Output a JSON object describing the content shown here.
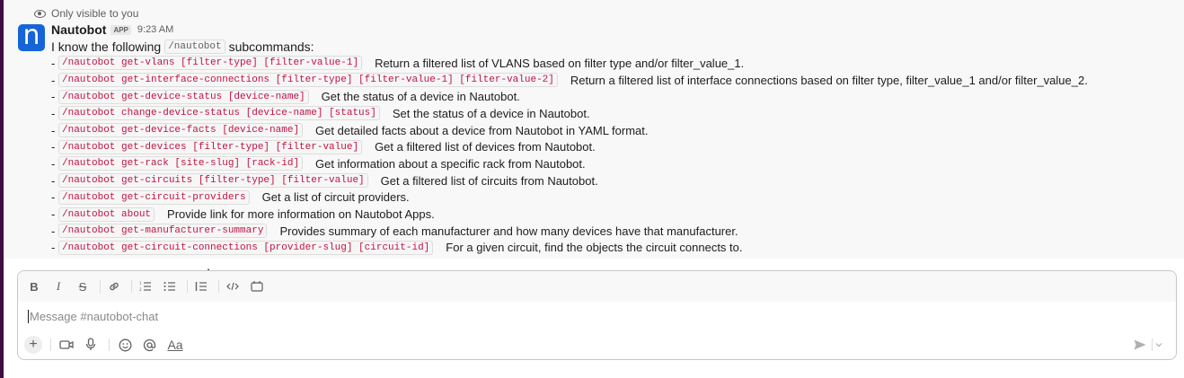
{
  "visibility_note": "Only visible to you",
  "message": {
    "avatar_letter": "n",
    "bot_name": "Nautobot",
    "app_badge": "APP",
    "timestamp": "9:23 AM",
    "intro_before": "I know the following",
    "intro_code": "/nautobot",
    "intro_after": "subcommands:",
    "bullet": "-",
    "commands": [
      {
        "cmd": "/nautobot get-vlans [filter-type] [filter-value-1]",
        "desc": "Return a filtered list of VLANS based on filter type and/or filter_value_1."
      },
      {
        "cmd": "/nautobot get-interface-connections [filter-type] [filter-value-1] [filter-value-2]",
        "desc": "Return a filtered list of interface connections based on filter type, filter_value_1 and/or filter_value_2."
      },
      {
        "cmd": "/nautobot get-device-status [device-name]",
        "desc": "Get the status of a device in Nautobot."
      },
      {
        "cmd": "/nautobot change-device-status [device-name] [status]",
        "desc": "Set the status of a device in Nautobot."
      },
      {
        "cmd": "/nautobot get-device-facts [device-name]",
        "desc": "Get detailed facts about a device from Nautobot in YAML format."
      },
      {
        "cmd": "/nautobot get-devices [filter-type] [filter-value]",
        "desc": "Get a filtered list of devices from Nautobot."
      },
      {
        "cmd": "/nautobot get-rack [site-slug] [rack-id]",
        "desc": "Get information about a specific rack from Nautobot."
      },
      {
        "cmd": "/nautobot get-circuits [filter-type] [filter-value]",
        "desc": "Get a filtered list of circuits from Nautobot."
      },
      {
        "cmd": "/nautobot get-circuit-providers",
        "desc": "Get a list of circuit providers."
      },
      {
        "cmd": "/nautobot about",
        "desc": "Provide link for more information on Nautobot Apps."
      },
      {
        "cmd": "/nautobot get-manufacturer-summary",
        "desc": "Provides summary of each manufacturer and how many devices have that manufacturer."
      },
      {
        "cmd": "/nautobot get-circuit-connections [provider-slug] [circuit-id]",
        "desc": "For a given circuit, find the objects the circuit connects to."
      }
    ]
  },
  "composer": {
    "placeholder": "Message #nautobot-chat",
    "format_buttons": {
      "bold": "B",
      "italic": "I",
      "strike": "S"
    },
    "text_format_label": "Aa",
    "icons": [
      "bold-icon",
      "italic-icon",
      "strikethrough-icon",
      "link-icon",
      "ordered-list-icon",
      "bulleted-list-icon",
      "blockquote-icon",
      "code-icon",
      "code-block-icon",
      "plus-icon",
      "video-icon",
      "microphone-icon",
      "emoji-icon",
      "mention-icon",
      "send-icon",
      "chevron-down-icon"
    ]
  },
  "colors": {
    "sidebar": "#3f0e40",
    "avatar": "#1565d8",
    "code_text": "#c01343"
  }
}
